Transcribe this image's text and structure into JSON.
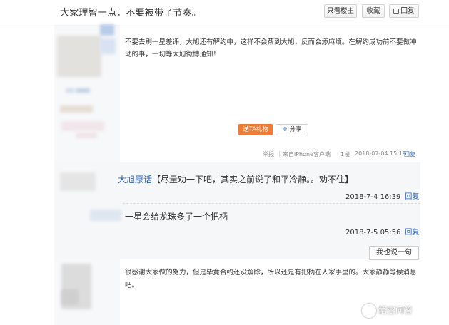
{
  "header": {
    "title": "大家理智一点，不要被带了节奏。",
    "only_op_label": "只看楼主",
    "favorite_label": "收藏",
    "reply_label": "回复"
  },
  "post": {
    "text": "不要去刷一星差评，大旭还有解约中，这样不会帮到大旭，反而会添麻烦。在解约成功前不要做冲动的事，一切等大旭微博通知！",
    "gift_label": "送TA礼物",
    "share_label": "分享",
    "meta": {
      "report": "举报",
      "separator": "|",
      "client": "来自iPhone客户端",
      "floor": "1楼",
      "time": "2018-07-04 15:19",
      "reply": "回复"
    }
  },
  "comments": [
    {
      "name": "大旭原话",
      "text": "【尽量劝一下吧，其实之前说了和平冷静。。劝不住】",
      "time": "2018-7-4 16:39",
      "reply": "回复"
    },
    {
      "name": "",
      "text": "一星会给龙珠多了一个把柄",
      "time": "2018-7-5 05:56",
      "reply": "回复"
    }
  ],
  "say_button_label": "我也说一句",
  "post2": {
    "text": "很感谢大家做的努力，但是毕竟合约还没解除，所以还是有把柄在人家手里的。大家静静等候消息吧。"
  },
  "watermark": {
    "text": "悟空问答"
  },
  "colors": {
    "link": "#2d64b3",
    "gift": "#ef7b36",
    "comment_bg": "#f6f7f9"
  }
}
